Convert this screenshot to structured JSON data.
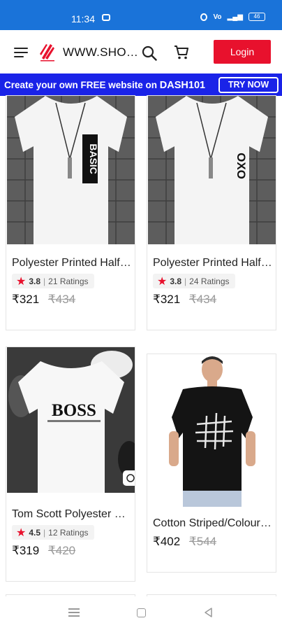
{
  "status_bar": {
    "time": "11:34",
    "battery": "46"
  },
  "header": {
    "site_title": "WWW.SHOPPYHUB.COM",
    "login_label": "Login"
  },
  "promo": {
    "text": "Create your own FREE website on ",
    "brand": "DASH101",
    "cta": "TRY NOW"
  },
  "products": [
    {
      "name": "Polyester Printed Half Sleeve T-Shirt",
      "rating": "3.8",
      "ratings_count": "21 Ratings",
      "price": "₹321",
      "mrp": "₹434",
      "print_text": "BASIC"
    },
    {
      "name": "Polyester Printed Half Sleeve T-Shirt",
      "rating": "3.8",
      "ratings_count": "24 Ratings",
      "price": "₹321",
      "mrp": "₹434",
      "print_text": "OXO"
    },
    {
      "name": "Tom Scott Polyester Printed T-Shirt",
      "rating": "4.5",
      "ratings_count": "12 Ratings",
      "price": "₹319",
      "mrp": "₹420",
      "print_text": "BOSS"
    },
    {
      "name": "Cotton Striped/Colourblocked T-Shirt",
      "price": "₹402",
      "mrp": "₹544"
    }
  ],
  "colors": {
    "status_bar": "#1a73d9",
    "promo_bg": "#1a23e8",
    "login_bg": "#e8112d",
    "star": "#e8112d"
  }
}
